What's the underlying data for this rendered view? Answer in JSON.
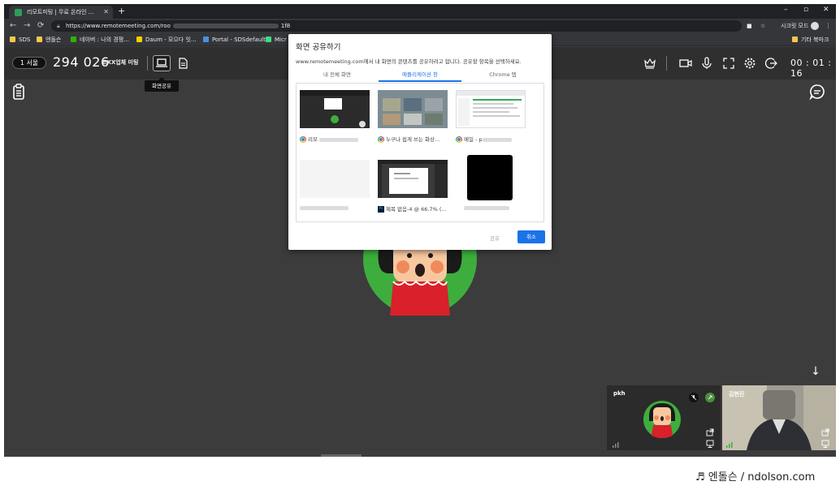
{
  "browser": {
    "tab_title": "리모트미팅 | 무료 온라인 ...",
    "new_tab": "+",
    "window_controls": [
      "–",
      "▫",
      "✕"
    ],
    "url_prefix": "https://www.remotemeeting.com/roo",
    "url_suffix": "1f8",
    "incognito_label": "시크릿 모드",
    "bookmarks": [
      {
        "label": "SDS",
        "color": "#f2c94c"
      },
      {
        "label": "엔돌슨",
        "color": "#f2c94c"
      },
      {
        "label": "네이버 : 나의 경쟁...",
        "color": "#2db400"
      },
      {
        "label": "Daum - 모으다 잇...",
        "color": "#ffcd00"
      },
      {
        "label": "Portal - SDSdefault",
        "color": "#4a90d9"
      },
      {
        "label": "Micr",
        "color": "#3ddc84"
      }
    ],
    "bookmarks_other": "기타 북마크"
  },
  "meeting": {
    "session_badge": "1 서울",
    "room_number": "294 026",
    "room_name": "코XX업체 미팅",
    "timer": "00 : 01 : 16",
    "tooltip": "화면공유"
  },
  "dialog": {
    "title": "화면 공유하기",
    "description": "www.remotemeeting.com에서 내 화면의 콘텐츠를 공유하려고 합니다. 공유할 항목을 선택하세요.",
    "tabs": [
      {
        "label": "내 전체 화면",
        "active": false
      },
      {
        "label": "애플리케이션 창",
        "active": true
      },
      {
        "label": "Chrome 탭",
        "active": false
      }
    ],
    "windows": [
      {
        "label": "리모",
        "app": "chrome"
      },
      {
        "label": "누구나 쉽게 쓰는 화상...",
        "app": "chrome"
      },
      {
        "label": "메일 - p",
        "app": "chrome"
      },
      {
        "label": "",
        "app": "blurred"
      },
      {
        "label": "제목 없음-4 @ 66.7% (...",
        "app": "photoshop"
      },
      {
        "label": "",
        "app": "blurred"
      }
    ],
    "share_button": "공유",
    "cancel_button": "취소"
  },
  "participants": [
    {
      "name": "pkh"
    },
    {
      "name": "김현진"
    }
  ],
  "credit": "♬ 엔돌슨 / ndolson.com",
  "colors": {
    "accent": "#1a73e8",
    "avatar_green": "#3dae3d",
    "avatar_red": "#d9202b"
  }
}
